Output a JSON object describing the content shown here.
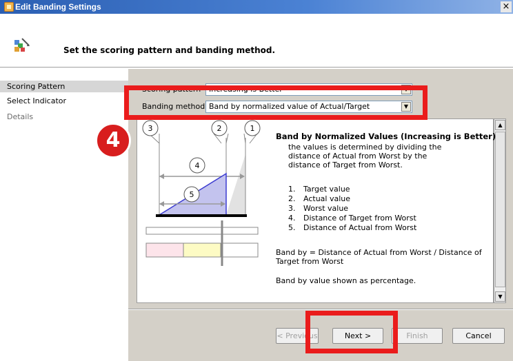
{
  "window": {
    "title": "Edit Banding Settings",
    "close_label": "×"
  },
  "header": {
    "instruction": "Set the scoring pattern and banding method."
  },
  "nav": {
    "items": [
      {
        "label": "Scoring Pattern"
      },
      {
        "label": "Select Indicator"
      },
      {
        "label": "Details"
      }
    ]
  },
  "form": {
    "scoring_label": "Scoring pattern",
    "scoring_value": "Increasing is Better",
    "banding_label": "Banding method",
    "banding_value": "Band by normalized value of Actual/Target"
  },
  "diagram": {
    "circle_labels": [
      "3",
      "2",
      "1",
      "4",
      "5"
    ]
  },
  "description": {
    "title": "Band by Normalized Values (Increasing is Better)",
    "line1": "the values is determined by dividing the",
    "line2": "distance of Actual from Worst by the",
    "line3": "distance of Target from Worst.",
    "list": [
      {
        "num": "1.",
        "text": "Target value"
      },
      {
        "num": "2.",
        "text": "Actual value"
      },
      {
        "num": "3.",
        "text": "Worst value"
      },
      {
        "num": "4.",
        "text": "Distance of Target from Worst"
      },
      {
        "num": "5.",
        "text": "Distance of Actual from Worst"
      }
    ],
    "formula_line1": "Band by = Distance of Actual from Worst / Distance of",
    "formula_line2": "Target from Worst",
    "note": "Band by value shown as percentage."
  },
  "buttons": {
    "previous": "< Previous",
    "next": "Next >",
    "finish": "Finish",
    "cancel": "Cancel"
  },
  "annotation": {
    "badge": "4"
  }
}
